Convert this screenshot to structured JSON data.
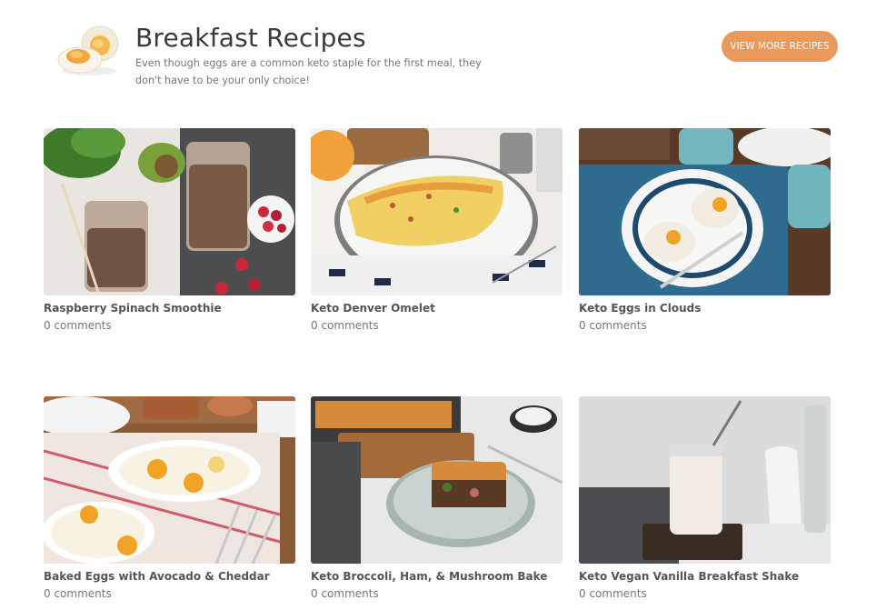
{
  "header": {
    "title": "Breakfast Recipes",
    "subtitle": "Even though eggs are a common keto staple for the first meal, they don't have to be your only choice!",
    "cta_label": "VIEW MORE RECIPES",
    "cta_color": "#e9995c",
    "logo_icon": "boiled-egg-icon"
  },
  "recipes": [
    {
      "name": "Raspberry Spinach Smoothie",
      "comments": "0 comments"
    },
    {
      "name": "Keto Denver Omelet",
      "comments": "0 comments"
    },
    {
      "name": "Keto Eggs in Clouds",
      "comments": "0 comments"
    },
    {
      "name": "Baked Eggs with Avocado & Cheddar",
      "comments": "0 comments"
    },
    {
      "name": "Keto Broccoli, Ham, & Mushroom Bake",
      "comments": "0 comments"
    },
    {
      "name": "Keto Vegan Vanilla Breakfast Shake",
      "comments": "0 comments"
    }
  ]
}
